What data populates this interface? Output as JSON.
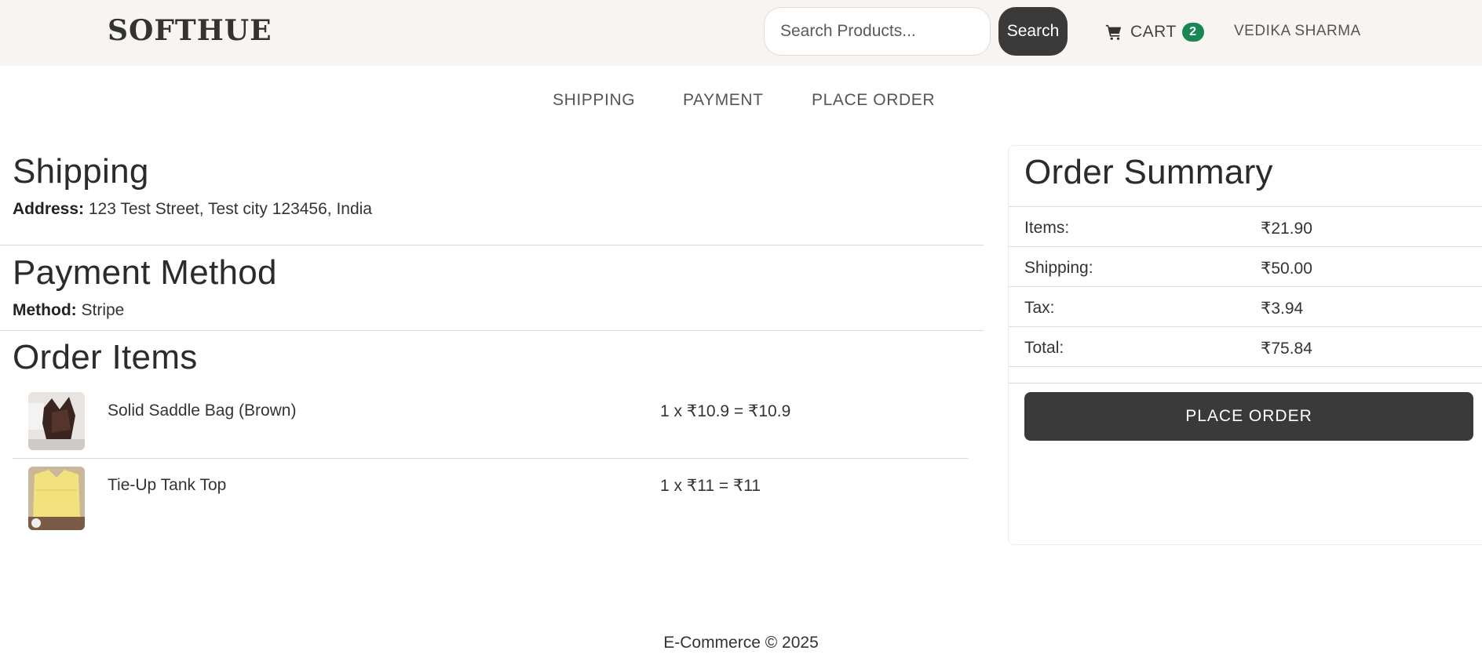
{
  "header": {
    "brand": "SOFTHUE",
    "search": {
      "placeholder": "Search Products...",
      "value": ""
    },
    "search_button": "Search",
    "cart": {
      "label": "CART",
      "count": "2",
      "icon": "cart-icon"
    },
    "user": "VEDIKA SHARMA"
  },
  "steps": [
    "SHIPPING",
    "PAYMENT",
    "PLACE ORDER"
  ],
  "shipping": {
    "title": "Shipping",
    "address_label": "Address:",
    "address": " 123 Test Street, Test city 123456, India"
  },
  "payment": {
    "title": "Payment Method",
    "method_label": "Method:",
    "method": " Stripe"
  },
  "order_items": {
    "title": "Order Items",
    "items": [
      {
        "name": "Solid Saddle Bag (Brown)",
        "calc": "1 x ₹10.9 = ₹10.9"
      },
      {
        "name": "Tie-Up Tank Top",
        "calc": "1 x ₹11 = ₹11"
      }
    ]
  },
  "summary": {
    "title": "Order Summary",
    "rows": [
      {
        "label": "Items:",
        "value": "₹21.90"
      },
      {
        "label": "Shipping:",
        "value": "₹50.00"
      },
      {
        "label": "Tax:",
        "value": "₹3.94"
      },
      {
        "label": "Total:",
        "value": "₹75.84"
      }
    ],
    "button": "PLACE ORDER"
  },
  "footer": "E-Commerce © 2025",
  "colors": {
    "header_bg": "#f7f4f1",
    "dark_button": "#3a3a3a",
    "badge_green": "#198754"
  }
}
